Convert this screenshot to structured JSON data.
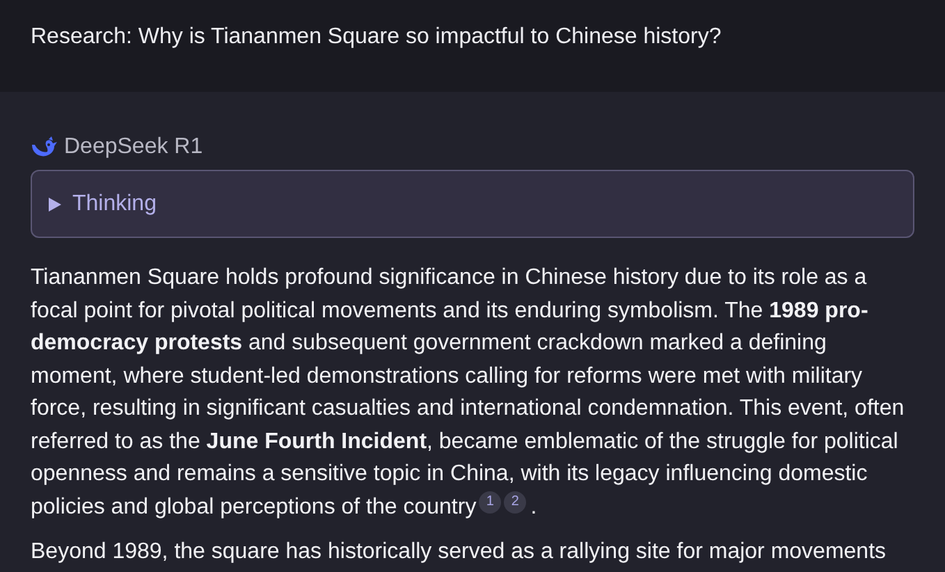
{
  "prompt": "Research: Why is Tiananmen Square so impactful to Chinese history?",
  "model": {
    "name": "DeepSeek R1"
  },
  "thinking": {
    "label": "Thinking",
    "expanded": false
  },
  "paragraphs": [
    {
      "text": "Tiananmen Square holds profound significance in Chinese history due to its role as a focal point for pivotal political movements and its enduring symbolism. The **1989 pro-democracy protests** and subsequent government crackdown marked a defining moment, where student-led demonstrations calling for reforms were met with military force, resulting in significant casualties and international condemnation. This event, often referred to as the **June Fourth Incident**, became emblematic of the struggle for political openness and remains a sensitive topic in China, with its legacy influencing domestic policies and global perceptions of the country",
      "citations": [
        "1",
        "2"
      ],
      "tail": "."
    },
    {
      "text": "Beyond 1989, the square has historically served as a rallying site for major movements"
    }
  ]
}
